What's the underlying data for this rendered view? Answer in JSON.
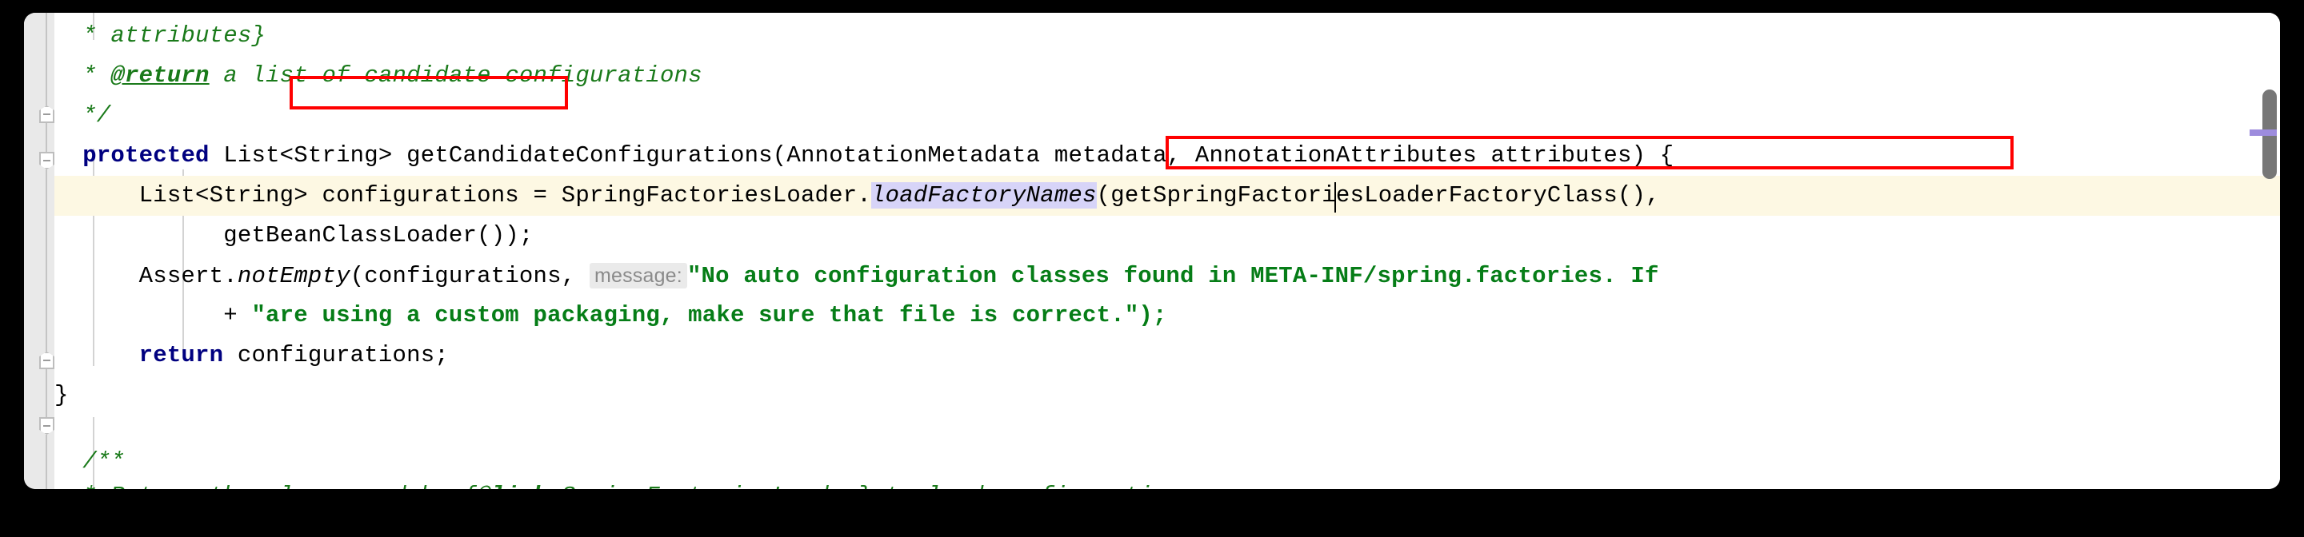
{
  "app": {
    "kind": "code-editor",
    "language": "Java",
    "theme": "light"
  },
  "colors": {
    "editor_background": "#ffffff",
    "letterbox": "#000000",
    "gutter_background": "#e9e9e9",
    "current_line_highlight": "#fdf8e3",
    "selection_highlight": "#d7d4f8",
    "keyword": "#000080",
    "comment": "#1a7a1a",
    "string": "#067d17",
    "annotation_box": "#ff0000",
    "param_hint_background": "#eaeaea",
    "param_hint_text": "#8a8a8a",
    "scrollbar_thumb": "#777777",
    "scroll_marker": "#9d8cdd"
  },
  "gutter": {
    "fold_markers": [
      {
        "name": "fold-marker-javadoc-end",
        "shape": "up",
        "glyph": "-"
      },
      {
        "name": "fold-marker-method-start",
        "shape": "down",
        "glyph": "-"
      },
      {
        "name": "fold-marker-method-end",
        "shape": "up",
        "glyph": "-"
      },
      {
        "name": "fold-marker-next-javadoc",
        "shape": "down",
        "glyph": "-"
      }
    ]
  },
  "code": {
    "lines": [
      {
        "id": "line-attributes",
        "text": "  * attributes}"
      },
      {
        "id": "line-return-tag",
        "prefix": "  * ",
        "tag": "@return",
        "rest": " a list of candidate configurations"
      },
      {
        "id": "line-comment-close",
        "text": "  */"
      },
      {
        "id": "line-method-signature",
        "keyword": "protected",
        "type": " List<String> ",
        "method_name": "getCandidateConfigurations",
        "params": "(AnnotationMetadata metadata, AnnotationAttributes attributes) {"
      },
      {
        "id": "line-configurations-assign",
        "indent": "    ",
        "before": "List<String> configurations = SpringFactoriesLoader.",
        "selected_method": "loadFactoryNames",
        "after": "(getSpringFactoriesLoaderFactoryClass(),",
        "current_line": true
      },
      {
        "id": "line-bean-classloader",
        "text": "            getBeanClassLoader());"
      },
      {
        "id": "line-assert-notempty",
        "indent": "    ",
        "receiver": "Assert.",
        "static_method": "notEmpty",
        "args_open": "(configurations, ",
        "param_hint": "message:",
        "string_part_1": "\"No auto configuration classes found in ",
        "string_boxed": "META-INF/spring.factories.",
        "string_part_2": " If"
      },
      {
        "id": "line-string-continuation",
        "indent": "            + ",
        "string": "\"are using a custom packaging, make sure that file is correct.\");"
      },
      {
        "id": "line-return-configurations",
        "indent": "    ",
        "keyword": "return",
        "rest": " configurations;"
      },
      {
        "id": "line-close-brace",
        "text": "}"
      },
      {
        "id": "line-blank",
        "text": ""
      },
      {
        "id": "line-javadoc-open",
        "text": "  /**"
      },
      {
        "id": "line-javadoc-return-class",
        "prefix": "  * Return the class used by {",
        "tag": "@link",
        "rest": " SpringFactoriesLoader} to load configuration"
      }
    ]
  },
  "annotations": [
    {
      "name": "annotation-box-method-name",
      "target": "getCandidateConfigurations"
    },
    {
      "name": "annotation-box-spring-factories-path",
      "target": "META-INF/spring.factories."
    }
  ],
  "caret": {
    "name": "text-caret",
    "inside": "loadFactoryNames"
  },
  "scrollbar": {
    "name": "vertical-scrollbar",
    "marker_label": "changed-lines-marker"
  }
}
